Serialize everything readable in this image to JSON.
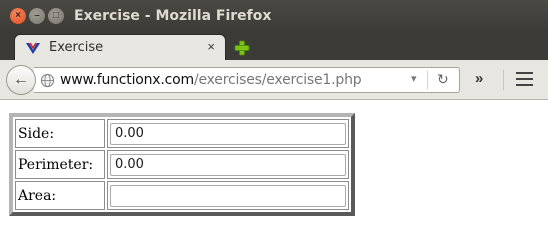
{
  "window": {
    "title": "Exercise - Mozilla Firefox",
    "controls": {
      "close": "×",
      "minimize": "–",
      "maximize": "□"
    }
  },
  "tabs": [
    {
      "label": "Exercise",
      "close_glyph": "×",
      "favicon": "functionx-v-icon"
    }
  ],
  "toolbar": {
    "back_glyph": "←",
    "url_domain": "www.functionx.com",
    "url_path": "/exercises/exercise1.php",
    "dropmarker_glyph": "▾",
    "reload_glyph": "↻",
    "overflow_glyph": "»",
    "new_tab_icon": "plus-icon",
    "menu_icon": "hamburger-icon"
  },
  "form": {
    "rows": [
      {
        "label": "Side:",
        "value": "0.00"
      },
      {
        "label": "Perimeter:",
        "value": "0.00"
      },
      {
        "label": "Area:",
        "value": ""
      }
    ]
  },
  "colors": {
    "titlebar": "#3c3b37",
    "close_button": "#df4a16",
    "new_tab_plus": "#7cc118",
    "favicon_v": "#1e3aa8"
  }
}
